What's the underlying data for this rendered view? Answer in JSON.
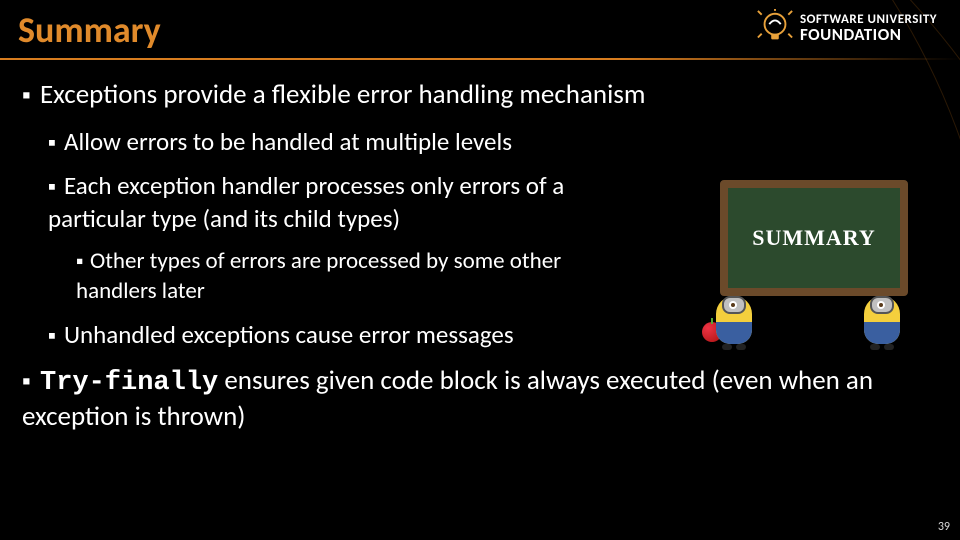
{
  "title": "Summary",
  "logo": {
    "line1": "SOFTWARE UNIVERSITY",
    "line2": "FOUNDATION"
  },
  "illustration_label": "SUMMARY",
  "bullets": {
    "l0": "Exceptions provide a flexible error handling mechanism",
    "l0_sub": [
      "Allow errors to be handled at multiple levels",
      "Each exception handler processes only errors of a particular type (and its child types)",
      "Unhandled exceptions cause error messages"
    ],
    "l0_sub_sub": "Other types of errors are processed by some other handlers later",
    "l1_code": "Try-finally",
    "l1_rest": " ensures given code block is always executed (even when an exception is thrown)"
  },
  "page_number": "39"
}
